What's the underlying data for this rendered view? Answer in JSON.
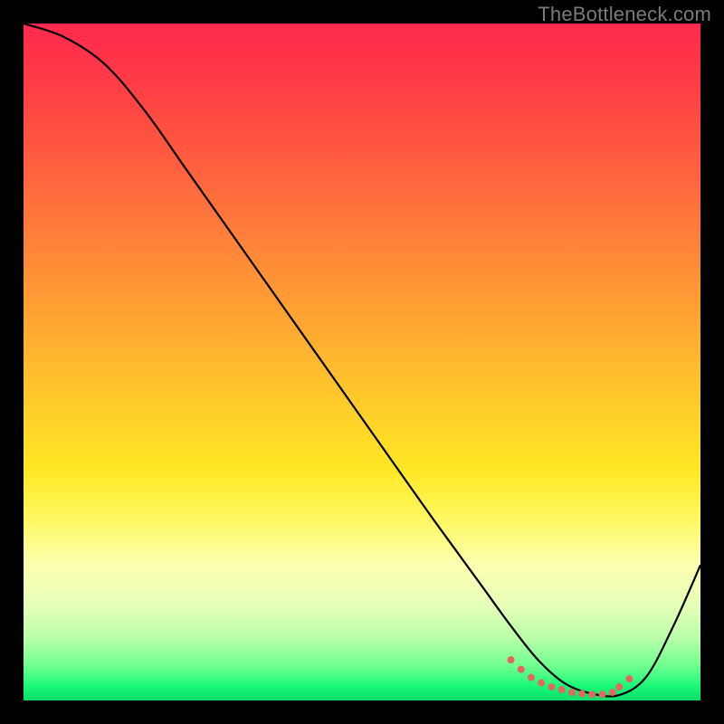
{
  "watermark": "TheBottleneck.com",
  "chart_data": {
    "type": "line",
    "title": "",
    "xlabel": "",
    "ylabel": "",
    "xlim": [
      0,
      100
    ],
    "ylim": [
      0,
      100
    ],
    "grid": false,
    "series": [
      {
        "name": "curve",
        "color": "#000000",
        "x": [
          0,
          6,
          12,
          18,
          24,
          30,
          36,
          42,
          48,
          54,
          60,
          64,
          68,
          72,
          76,
          80,
          84,
          88,
          92,
          96,
          100
        ],
        "values": [
          100,
          98,
          94,
          87,
          78.5,
          70,
          61.5,
          53,
          44.5,
          36,
          27.5,
          22,
          16.5,
          11,
          6,
          2.5,
          1.0,
          0.8,
          3.5,
          11,
          20
        ]
      },
      {
        "name": "highlight-dots",
        "color": "#e06860",
        "x": [
          72,
          73.5,
          75,
          76.5,
          78,
          79.5,
          81,
          82.5,
          84,
          85.5,
          87,
          88,
          89.5
        ],
        "values": [
          6.0,
          4.6,
          3.4,
          2.6,
          2.0,
          1.6,
          1.2,
          1.0,
          0.9,
          0.9,
          1.2,
          2.0,
          3.2
        ]
      }
    ],
    "annotations": []
  }
}
